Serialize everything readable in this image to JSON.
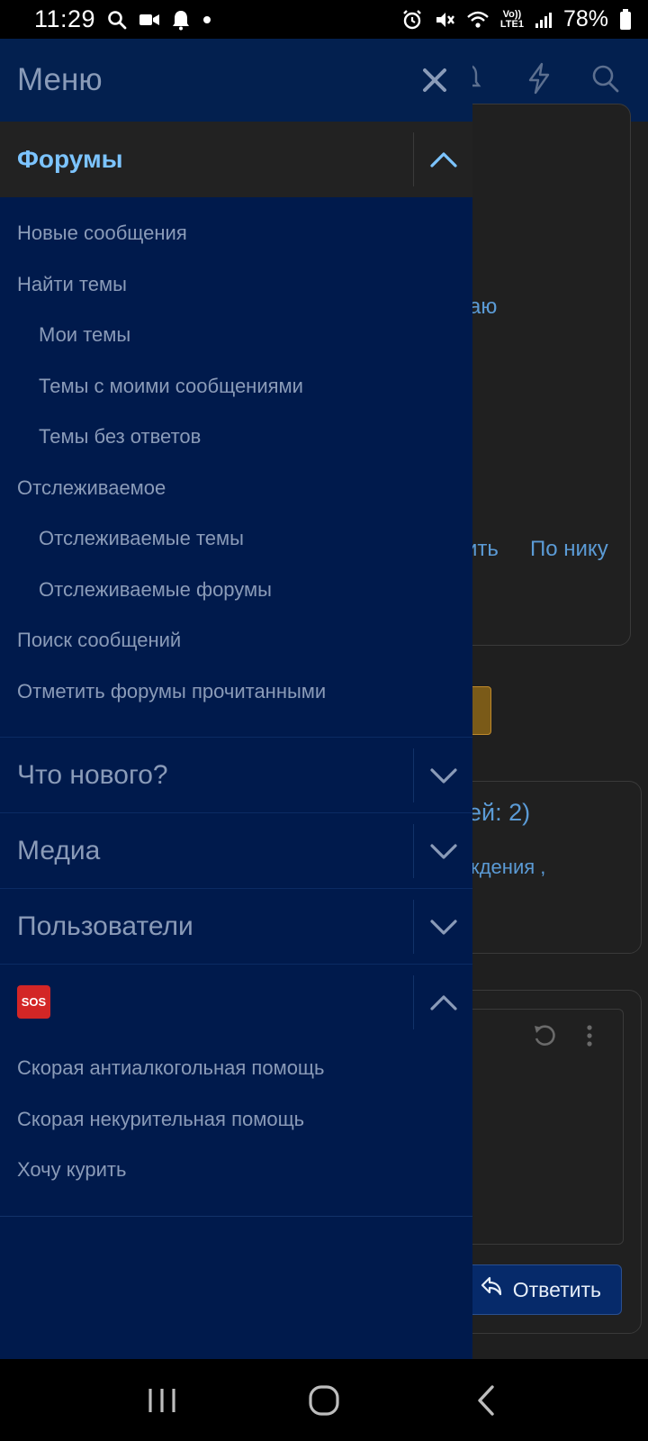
{
  "status_bar": {
    "time": "11:29",
    "battery": "78%",
    "network_top": "Vo))",
    "network_bottom": "LTE1",
    "icons": [
      "search-icon",
      "video-icon",
      "bell-icon",
      "dot-icon",
      "alarm-icon",
      "mute-icon",
      "wifi-icon",
      "signal-icon",
      "battery-icon"
    ]
  },
  "drawer": {
    "title": "Меню",
    "close_icon": "close-icon",
    "sections": [
      {
        "label": "Форумы",
        "expanded": true,
        "items": [
          {
            "label": "Новые сообщения",
            "indent": false
          },
          {
            "label": "Найти темы",
            "indent": false
          },
          {
            "label": "Мои темы",
            "indent": true
          },
          {
            "label": "Темы с моими сообщениями",
            "indent": true
          },
          {
            "label": "Темы без ответов",
            "indent": true
          },
          {
            "label": "Отслеживаемое",
            "indent": false
          },
          {
            "label": "Отслеживаемые темы",
            "indent": true
          },
          {
            "label": "Отслеживаемые форумы",
            "indent": true
          },
          {
            "label": "Поиск сообщений",
            "indent": false
          },
          {
            "label": "Отметить форумы прочитанными",
            "indent": false
          }
        ]
      },
      {
        "label": "Что нового?",
        "expanded": false
      },
      {
        "label": "Медиа",
        "expanded": false
      },
      {
        "label": "Пользователи",
        "expanded": false
      },
      {
        "label": "SOS",
        "expanded": true,
        "items": [
          {
            "label": "Скорая антиалкогольная помощь",
            "indent": false
          },
          {
            "label": "Скорая некурительная помощь",
            "indent": false
          },
          {
            "label": "Хочу курить",
            "indent": false
          }
        ]
      }
    ]
  },
  "background": {
    "text_1": "аю",
    "text_2": "ить",
    "text_3": "По нику",
    "text_4": "ей: 2)",
    "text_5": "ждения ,",
    "reply_button": "Ответить"
  },
  "colors": {
    "drawer_bg": "#001a4c",
    "header_bg": "#03204f",
    "active_section_bg": "#222222",
    "active_label": "#7cc4ff",
    "muted_label": "#8a9bb8",
    "sos_red": "#d32626"
  }
}
